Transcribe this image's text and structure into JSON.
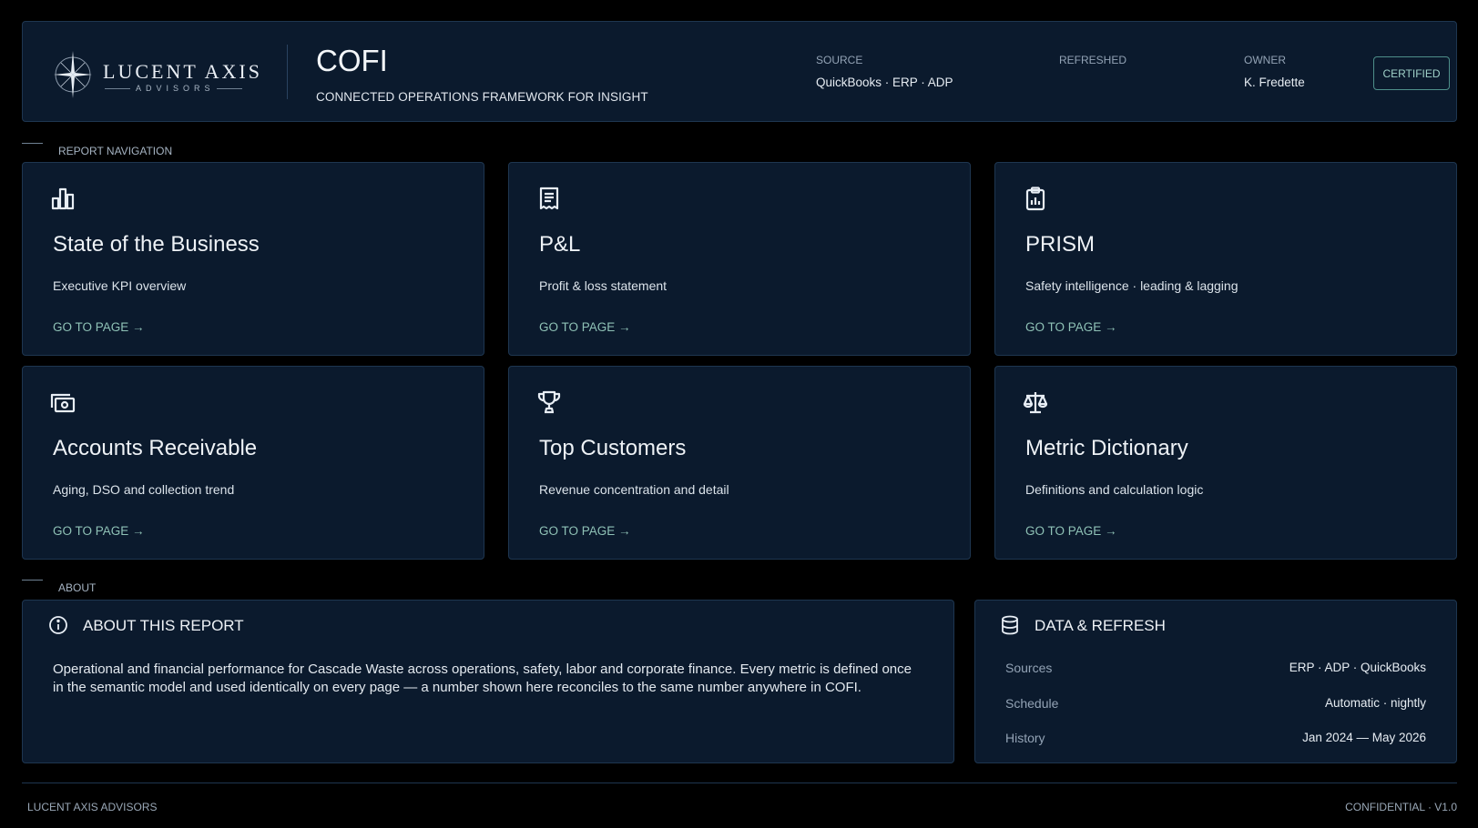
{
  "header": {
    "logo_name": "LUCENT AXIS",
    "logo_sub": "ADVISORS",
    "title": "COFI",
    "subtitle": "CONNECTED OPERATIONS FRAMEWORK FOR INSIGHT",
    "meta": [
      {
        "label": "SOURCE",
        "value": "QuickBooks · ERP · ADP"
      },
      {
        "label": "REFRESHED",
        "value": ""
      },
      {
        "label": "OWNER",
        "value": "K. Fredette"
      }
    ],
    "certified_label": "CERTIFIED"
  },
  "nav": {
    "section_label": "REPORT NAVIGATION",
    "cards": [
      {
        "icon": "bar-chart-icon",
        "title": "State of the Business",
        "desc": "Executive KPI overview",
        "cta": "GO TO PAGE →"
      },
      {
        "icon": "receipt-icon",
        "title": "P&L",
        "desc": "Profit & loss statement",
        "cta": "GO TO PAGE →"
      },
      {
        "icon": "clipboard-icon",
        "title": "PRISM",
        "desc": "Safety intelligence · leading & lagging",
        "cta": "GO TO PAGE →"
      },
      {
        "icon": "cash-icon",
        "title": "Accounts Receivable",
        "desc": "Aging, DSO and collection trend",
        "cta": "GO TO PAGE →"
      },
      {
        "icon": "trophy-icon",
        "title": "Top Customers",
        "desc": "Revenue concentration and detail",
        "cta": "GO TO PAGE →"
      },
      {
        "icon": "scale-icon",
        "title": "Metric Dictionary",
        "desc": "Definitions and calculation logic",
        "cta": "GO TO PAGE →"
      }
    ]
  },
  "about": {
    "section_label": "ABOUT",
    "title": "ABOUT THIS REPORT",
    "text": "Operational and financial performance for Cascade Waste across operations, safety, labor and corporate finance. Every metric is defined once in the semantic model and used identically on every page — a number shown here reconciles to the same number anywhere in COFI."
  },
  "data_refresh": {
    "title": "DATA & REFRESH",
    "rows": [
      {
        "key": "Sources",
        "value": "ERP · ADP · QuickBooks"
      },
      {
        "key": "Schedule",
        "value": "Automatic · nightly"
      },
      {
        "key": "History",
        "value": "Jan 2024 — May 2026"
      }
    ]
  },
  "footer": {
    "left": "LUCENT AXIS ADVISORS",
    "right": "CONFIDENTIAL · V1.0"
  },
  "colors": {
    "background": "#000000",
    "card": "#0b1a2d",
    "border": "#1e3650",
    "accent": "#8fc2b6"
  }
}
